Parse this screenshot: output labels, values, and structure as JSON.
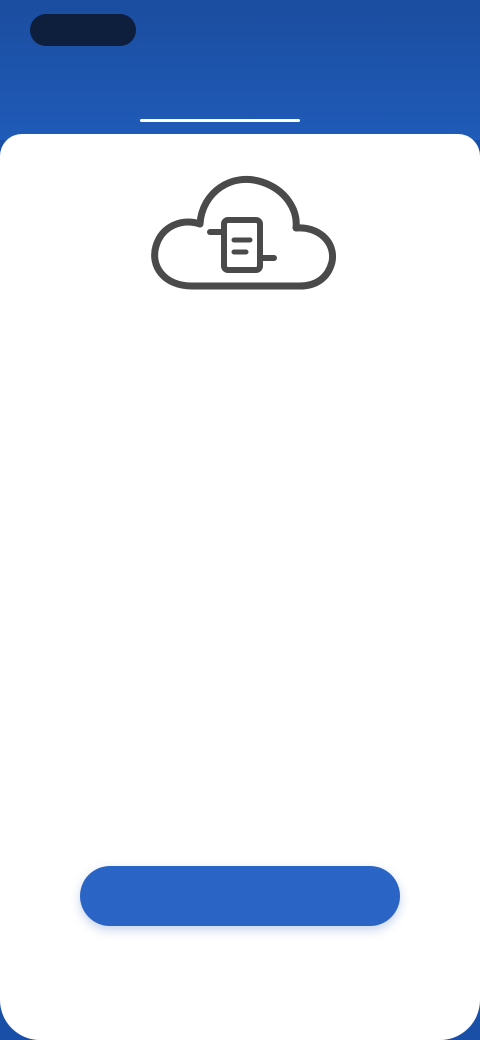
{
  "header": {
    "logo_text": "",
    "action_label": "",
    "brand_color": "#1f5bb8"
  },
  "tabs": [
    {
      "label": "",
      "active": false
    },
    {
      "label": "",
      "active": true
    }
  ],
  "main": {
    "icon": "cloud-sync-icon",
    "paragraph_1": "",
    "paragraph_2": "",
    "paragraph_3": "",
    "button_label": ""
  }
}
